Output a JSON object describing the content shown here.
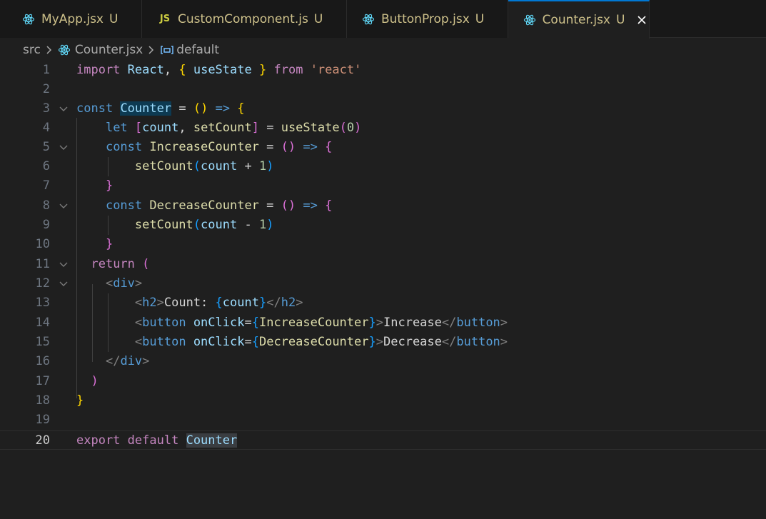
{
  "tabs": [
    {
      "label": "MyApp.jsx",
      "status": "U",
      "icon": "react-icon"
    },
    {
      "label": "CustomComponent.js",
      "status": "U",
      "icon": "js-icon"
    },
    {
      "label": "ButtonProp.jsx",
      "status": "U",
      "icon": "react-icon"
    },
    {
      "label": "Counter.jsx",
      "status": "U",
      "icon": "react-icon",
      "active": true
    }
  ],
  "js_badge": "JS",
  "breadcrumb": {
    "folder": "src",
    "file": "Counter.jsx",
    "symbol": "default"
  },
  "editor": {
    "current_line": 20,
    "lines": [
      {
        "n": "1"
      },
      {
        "n": "2"
      },
      {
        "n": "3"
      },
      {
        "n": "4"
      },
      {
        "n": "5"
      },
      {
        "n": "6"
      },
      {
        "n": "7"
      },
      {
        "n": "8"
      },
      {
        "n": "9"
      },
      {
        "n": "10"
      },
      {
        "n": "11"
      },
      {
        "n": "12"
      },
      {
        "n": "13"
      },
      {
        "n": "14"
      },
      {
        "n": "15"
      },
      {
        "n": "16"
      },
      {
        "n": "17"
      },
      {
        "n": "18"
      },
      {
        "n": "19"
      },
      {
        "n": "20"
      }
    ],
    "code": {
      "l1": [
        "import",
        " ",
        "React",
        ", ",
        "{",
        " ",
        "useState",
        " ",
        "}",
        " ",
        "from",
        " ",
        "'react'"
      ],
      "l3": [
        "const",
        " ",
        "Counter",
        " = ",
        "(",
        ")",
        " ",
        "=>",
        " ",
        "{"
      ],
      "l4": [
        "    ",
        "let",
        " ",
        "[",
        "count",
        ", ",
        "setCount",
        "]",
        " = ",
        "useState",
        "(",
        "0",
        ")"
      ],
      "l5": [
        "    ",
        "const",
        " ",
        "IncreaseCounter",
        " = ",
        "(",
        ")",
        " ",
        "=>",
        " ",
        "{"
      ],
      "l6": [
        "        ",
        "setCount",
        "(",
        "count",
        " + ",
        "1",
        ")"
      ],
      "l7": [
        "    ",
        "}"
      ],
      "l8": [
        "    ",
        "const",
        " ",
        "DecreaseCounter",
        " = ",
        "(",
        ")",
        " ",
        "=>",
        " ",
        "{"
      ],
      "l9": [
        "        ",
        "setCount",
        "(",
        "count",
        " - ",
        "1",
        ")"
      ],
      "l10": [
        "    ",
        "}"
      ],
      "l11": [
        "  ",
        "return",
        " ",
        "("
      ],
      "l12": [
        "    ",
        "<",
        "div",
        ">"
      ],
      "l13": [
        "        ",
        "<",
        "h2",
        ">",
        "Count: ",
        "{",
        "count",
        "}",
        "</",
        "h2",
        ">"
      ],
      "l14": [
        "        ",
        "<",
        "button",
        " ",
        "onClick",
        "=",
        "{",
        "IncreaseCounter",
        "}",
        ">",
        "Increase",
        "</",
        "button",
        ">"
      ],
      "l15": [
        "        ",
        "<",
        "button",
        " ",
        "onClick",
        "=",
        "{",
        "DecreaseCounter",
        "}",
        ">",
        "Decrease",
        "</",
        "button",
        ">"
      ],
      "l16": [
        "    ",
        "</",
        "div",
        ">"
      ],
      "l17": [
        "  ",
        ")"
      ],
      "l18": [
        "}"
      ],
      "l20": [
        "export",
        " ",
        "default",
        " ",
        "Counter"
      ]
    }
  },
  "colors": {
    "accent": "#0078d4",
    "modified_file": "#cdc08a",
    "react_icon": "#61dafb",
    "js_icon": "#cbcb41",
    "editor_bg": "#1f1f1f",
    "tabbar_bg": "#181818"
  }
}
